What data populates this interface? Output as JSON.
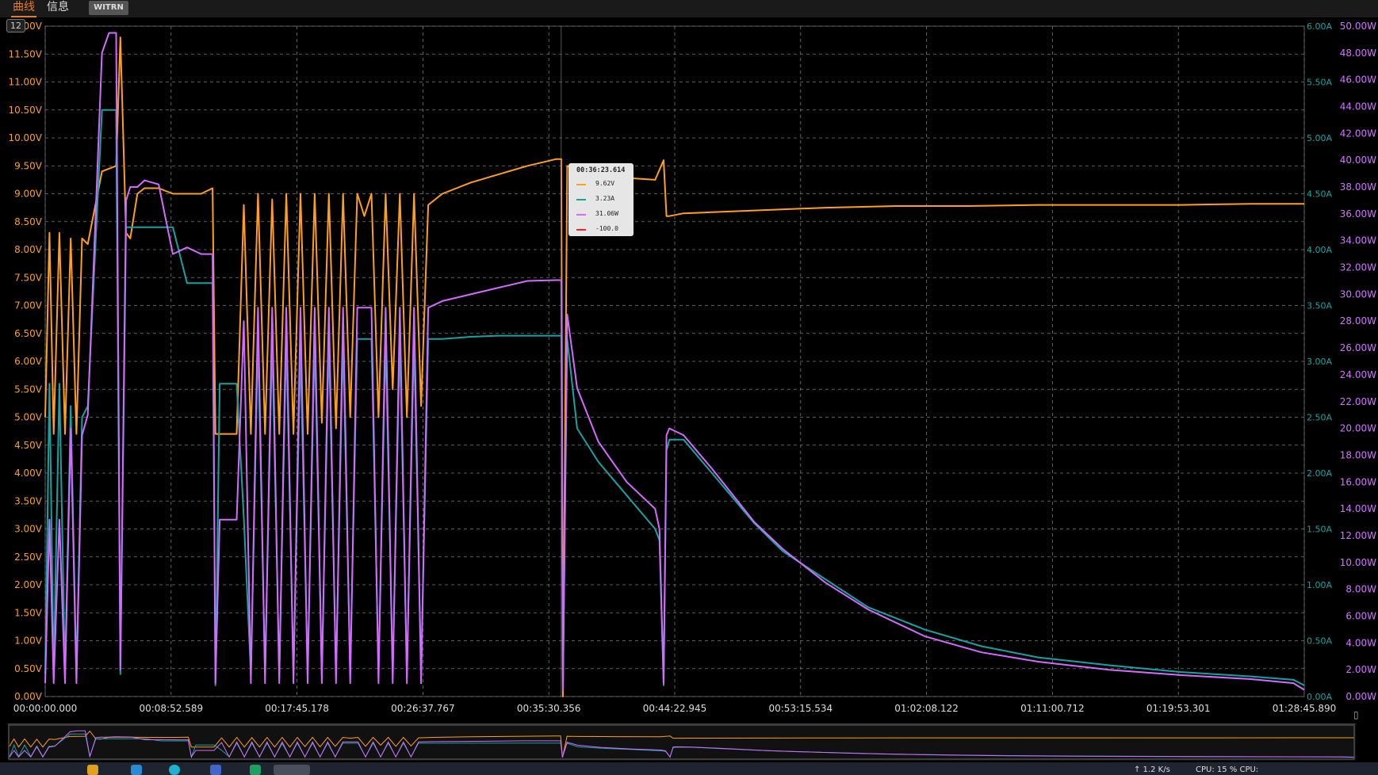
{
  "tabs": [
    {
      "label": "曲线",
      "active": true
    },
    {
      "label": "信息",
      "active": false
    }
  ],
  "brand": "WITRN",
  "page_badge": "12",
  "colors": {
    "voltage": "#ff9f1c",
    "current": "#17a2a2",
    "power": "#d36bff",
    "dp": "#ff2020",
    "current_axis": "#14a5a5",
    "power_axis": "#d075ff",
    "grid": "#777777"
  },
  "tooltip": {
    "time": "00:36:23.614",
    "rows": [
      {
        "value": "9.62V",
        "series": "voltage"
      },
      {
        "value": "3.23A",
        "series": "current"
      },
      {
        "value": "31.06W",
        "series": "power"
      },
      {
        "value": "-100.0",
        "series": "dp"
      }
    ]
  },
  "taskbar": {
    "net": "↑ 1.2 K/s",
    "cpu": "CPU: 15 %  CPU:"
  },
  "chart_data": {
    "type": "line",
    "x_ticks": [
      "00:00:00.000",
      "00:08:52.589",
      "00:17:45.178",
      "00:26:37.767",
      "00:35:30.356",
      "00:44:22.945",
      "00:53:15.534",
      "01:02:08.122",
      "01:11:00.712",
      "01:19:53.301",
      "01:28:45.890"
    ],
    "x_range_min": [
      0,
      88.76
    ],
    "y_left": {
      "ticks": [
        "12.00V",
        "11.50V",
        "11.00V",
        "10.50V",
        "10.00V",
        "9.50V",
        "9.00V",
        "8.50V",
        "8.00V",
        "7.50V",
        "7.00V",
        "6.50V",
        "6.00V",
        "5.50V",
        "5.00V",
        "4.50V",
        "4.00V",
        "3.50V",
        "3.00V",
        "2.50V",
        "2.00V",
        "1.50V",
        "1.00V",
        "0.50V",
        "0.00V"
      ],
      "range": [
        0,
        12
      ]
    },
    "y_right_current": {
      "ticks": [
        "6.00A",
        "5.50A",
        "5.00A",
        "4.50A",
        "4.00A",
        "3.50A",
        "3.00A",
        "2.50A",
        "2.00A",
        "1.50A",
        "1.00A",
        "0.50A",
        "0.00A"
      ],
      "range": [
        0,
        6
      ]
    },
    "y_right_power": {
      "ticks": [
        "50.00W",
        "48.00W",
        "46.00W",
        "44.00W",
        "42.00W",
        "40.00W",
        "38.00W",
        "36.00W",
        "34.00W",
        "32.00W",
        "30.00W",
        "28.00W",
        "26.00W",
        "24.00W",
        "22.00W",
        "20.00W",
        "18.00W",
        "16.00W",
        "14.00W",
        "12.00W",
        "10.00W",
        "8.00W",
        "6.00W",
        "4.00W",
        "2.00W",
        "0.00W"
      ],
      "range": [
        0,
        50
      ]
    },
    "grid": true,
    "series": [
      {
        "key": "voltage",
        "unit": "V",
        "x": [
          0,
          0.3,
          0.6,
          1.0,
          1.4,
          1.8,
          2.2,
          2.6,
          3.0,
          4.0,
          5.0,
          5.3,
          5.7,
          6.0,
          6.5,
          7.0,
          8.0,
          9.0,
          10.0,
          11.0,
          11.8,
          12.0,
          12.3,
          13.5,
          14.0,
          14.5,
          15.0,
          15.5,
          16.0,
          16.5,
          17.0,
          17.5,
          18.0,
          18.5,
          19.0,
          19.5,
          20.0,
          20.5,
          21.0,
          21.5,
          22.0,
          22.5,
          23.0,
          23.5,
          24.0,
          24.5,
          25.0,
          25.5,
          26.0,
          26.5,
          27.0,
          28.0,
          30.0,
          32.0,
          34.0,
          36.0,
          36.38,
          36.5,
          36.8,
          37.5,
          40.0,
          43.0,
          43.6,
          43.8,
          44.0,
          45.0,
          50.0,
          55.0,
          60.0,
          65.0,
          70.0,
          75.0,
          80.0,
          85.0,
          88.76
        ],
        "y": [
          5.0,
          8.3,
          4.7,
          8.3,
          4.7,
          8.2,
          4.7,
          8.2,
          8.1,
          9.4,
          9.5,
          11.8,
          8.3,
          8.2,
          9.0,
          9.1,
          9.1,
          9.0,
          9.0,
          9.0,
          9.1,
          4.7,
          4.7,
          4.7,
          8.8,
          4.7,
          9.0,
          4.7,
          8.9,
          4.7,
          9.0,
          4.7,
          9.0,
          4.7,
          9.0,
          4.9,
          9.0,
          4.8,
          9.0,
          5.0,
          9.0,
          8.6,
          9.0,
          5.0,
          9.0,
          5.5,
          9.0,
          5.0,
          9.0,
          5.2,
          8.8,
          9.0,
          9.2,
          9.35,
          9.5,
          9.62,
          9.62,
          0.0,
          9.5,
          9.4,
          9.3,
          9.25,
          9.6,
          8.6,
          8.6,
          8.65,
          8.7,
          8.75,
          8.78,
          8.78,
          8.8,
          8.8,
          8.8,
          8.82,
          8.82
        ]
      },
      {
        "key": "current",
        "unit": "A",
        "x": [
          0,
          0.3,
          0.6,
          1.0,
          1.4,
          1.8,
          2.2,
          2.6,
          3.0,
          4.0,
          5.0,
          5.3,
          5.7,
          6.0,
          6.5,
          7.0,
          8.0,
          9.0,
          10.0,
          11.0,
          11.8,
          12.0,
          12.3,
          13.5,
          14.0,
          14.5,
          15.0,
          15.5,
          16.0,
          16.5,
          17.0,
          17.5,
          18.0,
          18.5,
          19.0,
          19.5,
          20.0,
          20.5,
          21.0,
          21.5,
          22.0,
          22.5,
          23.0,
          23.5,
          24.0,
          24.5,
          25.0,
          25.5,
          26.0,
          26.5,
          27.0,
          28.0,
          30.0,
          32.0,
          34.0,
          36.0,
          36.38,
          36.5,
          36.8,
          37.5,
          39.0,
          41.0,
          43.0,
          43.3,
          43.6,
          43.8,
          44.0,
          45.0,
          47.0,
          50.0,
          52.0,
          55.0,
          58.0,
          62.0,
          66.0,
          70.0,
          75.0,
          80.0,
          85.0,
          88.0,
          88.76
        ],
        "y": [
          0.2,
          2.8,
          0.2,
          2.8,
          0.2,
          2.6,
          0.2,
          2.5,
          2.6,
          5.25,
          5.25,
          0.2,
          4.2,
          4.2,
          4.2,
          4.2,
          4.2,
          4.2,
          3.7,
          3.7,
          3.7,
          0.1,
          2.8,
          2.8,
          1.6,
          0.2,
          3.2,
          0.2,
          3.2,
          0.2,
          3.2,
          0.2,
          3.1,
          0.2,
          3.2,
          0.2,
          3.2,
          0.2,
          3.2,
          0.2,
          3.2,
          3.2,
          3.2,
          0.2,
          3.2,
          0.2,
          3.2,
          0.2,
          3.2,
          0.2,
          3.2,
          3.2,
          3.22,
          3.23,
          3.23,
          3.23,
          3.23,
          0.1,
          3.2,
          2.4,
          2.1,
          1.8,
          1.5,
          1.4,
          0.1,
          2.2,
          2.3,
          2.3,
          2.0,
          1.55,
          1.3,
          1.05,
          0.8,
          0.6,
          0.45,
          0.35,
          0.28,
          0.22,
          0.18,
          0.15,
          0.1
        ]
      },
      {
        "key": "power",
        "unit": "W",
        "x": [
          0,
          0.3,
          0.6,
          1.0,
          1.4,
          1.8,
          2.2,
          2.6,
          3.0,
          4.0,
          4.5,
          5.0,
          5.3,
          5.7,
          6.0,
          6.5,
          7.0,
          8.0,
          9.0,
          10.0,
          11.0,
          11.8,
          12.0,
          12.3,
          13.5,
          14.0,
          14.5,
          15.0,
          15.5,
          16.0,
          16.5,
          17.0,
          17.5,
          18.0,
          18.5,
          19.0,
          19.5,
          20.0,
          20.5,
          21.0,
          21.5,
          22.0,
          22.5,
          23.0,
          23.5,
          24.0,
          24.5,
          25.0,
          25.5,
          26.0,
          26.5,
          27.0,
          28.0,
          30.0,
          32.0,
          34.0,
          36.0,
          36.38,
          36.5,
          36.8,
          37.5,
          39.0,
          41.0,
          43.0,
          43.3,
          43.6,
          43.8,
          44.0,
          45.0,
          47.0,
          50.0,
          52.0,
          55.0,
          58.0,
          62.0,
          66.0,
          70.0,
          75.0,
          80.0,
          85.0,
          88.0,
          88.76
        ],
        "y": [
          1.0,
          13.2,
          1.0,
          13.2,
          1.0,
          20.0,
          1.0,
          19.5,
          21.0,
          48.0,
          49.5,
          49.5,
          2.0,
          37.0,
          38.0,
          38.0,
          38.5,
          38.2,
          33.0,
          33.5,
          33.0,
          33.0,
          1.0,
          13.2,
          13.2,
          28.0,
          1.0,
          29.0,
          1.0,
          29.0,
          1.0,
          29.0,
          1.0,
          29.0,
          1.0,
          29.0,
          1.0,
          29.0,
          1.0,
          29.0,
          1.0,
          29.0,
          29.0,
          29.0,
          1.0,
          29.0,
          1.0,
          29.0,
          1.0,
          29.0,
          1.0,
          29.0,
          29.5,
          30.0,
          30.5,
          31.0,
          31.06,
          31.06,
          0.5,
          28.5,
          23.0,
          19.0,
          16.0,
          14.0,
          12.5,
          1.0,
          19.5,
          20.0,
          19.5,
          17.0,
          13.0,
          11.0,
          8.5,
          6.5,
          4.5,
          3.3,
          2.6,
          2.0,
          1.6,
          1.3,
          1.0,
          0.5
        ]
      }
    ]
  }
}
